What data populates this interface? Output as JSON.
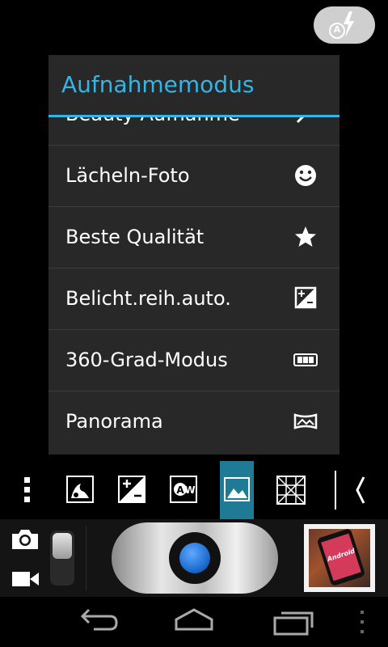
{
  "flash": {
    "mode_badge": "A",
    "icon": "flash-auto-icon"
  },
  "dialog": {
    "title": "Aufnahmemodus",
    "items": [
      {
        "label": "Beauty-Aufnahme",
        "icon": "beauty-wand-icon"
      },
      {
        "label": "Lächeln-Foto",
        "icon": "smile-icon"
      },
      {
        "label": "Beste Qualität",
        "icon": "star-icon"
      },
      {
        "label": "Belicht.reih.auto.",
        "icon": "exposure-icon"
      },
      {
        "label": "360-Grad-Modus",
        "icon": "360-icon"
      },
      {
        "label": "Panorama",
        "icon": "panorama-icon"
      }
    ]
  },
  "toolbar": {
    "items": [
      "menu-icon",
      "scene-icon",
      "exposure-icon",
      "white-balance-icon",
      "landscape-icon",
      "grid-icon",
      "collapse-chevron-icon"
    ],
    "awb_badge": "W"
  },
  "colors": {
    "accent": "#33b5e5",
    "dialog_bg": "#282828",
    "selected_tool": "#1f7a95",
    "shutter_blue": "#1e6fd1"
  },
  "gallery": {
    "thumbnail_text": "Android"
  }
}
